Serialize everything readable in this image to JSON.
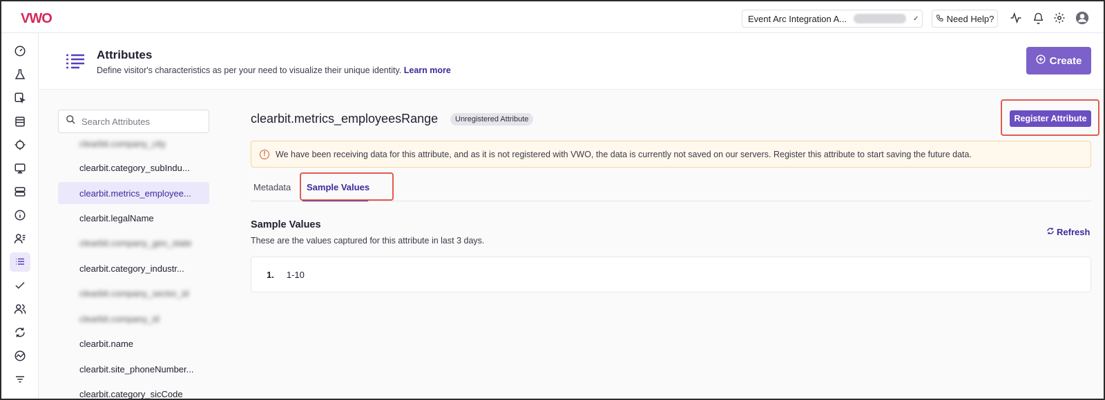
{
  "brand": {
    "logo_text": "VWO",
    "accent": "#5a3db8",
    "primary_button": "#7b61c9"
  },
  "topbar": {
    "account_label": "Event Arc Integration A...",
    "help_label": "Need Help?",
    "icons": [
      "activity-icon",
      "bell-icon",
      "gear-icon",
      "user-avatar-icon"
    ]
  },
  "sidebar": {
    "icons": [
      "dashboard-icon",
      "flask-icon",
      "edit-cursor-icon",
      "calendar-icon",
      "target-icon",
      "screen-icon",
      "server-icon",
      "info-icon",
      "users-list-icon",
      "attributes-list-icon",
      "check-icon",
      "users-icon",
      "sync-icon",
      "chart-icon",
      "filter-icon"
    ],
    "active": "attributes-list-icon"
  },
  "header": {
    "title": "Attributes",
    "description": "Define visitor's characteristics as per your need to visualize their unique identity.",
    "learn_more": "Learn more",
    "create_label": "Create"
  },
  "list": {
    "search_placeholder": "Search Attributes",
    "items": [
      {
        "label": "clearbit.company_city",
        "blurred": true
      },
      {
        "label": "clearbit.category_subIndu...",
        "blurred": false
      },
      {
        "label": "clearbit.metrics_employee...",
        "blurred": false,
        "active": true
      },
      {
        "label": "clearbit.legalName",
        "blurred": false
      },
      {
        "label": "clearbit.company_geo_state",
        "blurred": true
      },
      {
        "label": "clearbit.category_industr...",
        "blurred": false
      },
      {
        "label": "clearbit.company_sector_id",
        "blurred": true
      },
      {
        "label": "clearbit.company_id",
        "blurred": true
      },
      {
        "label": "clearbit.name",
        "blurred": false
      },
      {
        "label": "clearbit.site_phoneNumber...",
        "blurred": false
      },
      {
        "label": "clearbit.category_sicCode",
        "blurred": false
      }
    ]
  },
  "detail": {
    "attribute_name": "clearbit.metrics_employeesRange",
    "badge": "Unregistered Attribute",
    "register_label": "Register Attribute",
    "warning": "We have been receiving data for this attribute, and as it is not registered with VWO, the data is currently not saved on our servers. Register this attribute to start saving the future data.",
    "tabs": [
      {
        "label": "Metadata"
      },
      {
        "label": "Sample Values",
        "active": true
      }
    ],
    "section_title": "Sample Values",
    "section_desc": "These are the values captured for this attribute in last 3 days.",
    "refresh_label": "Refresh",
    "values": [
      {
        "index": "1.",
        "value": "1-10"
      }
    ]
  }
}
